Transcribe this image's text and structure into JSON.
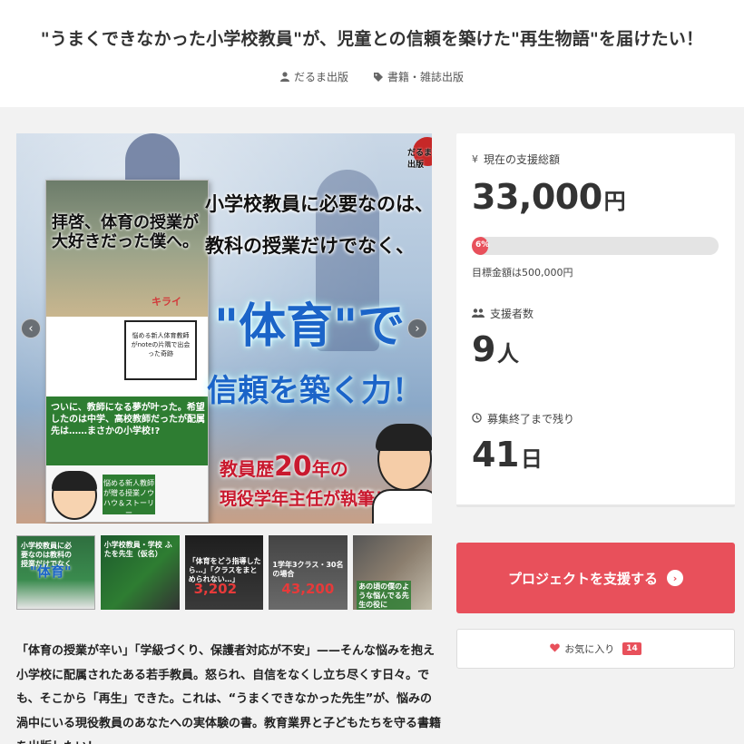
{
  "header": {
    "title": "\"うまくできなかった小学校教員\"が、児童との信頼を築けた\"再生物語\"を届けたい！",
    "author": "だるま出版",
    "category": "書籍・雑誌出版"
  },
  "hero": {
    "logo_text": "だるま出版",
    "line1": "小学校教員に必要なのは、",
    "line2": "教科の授業だけでなく、",
    "big1": "\"体育\"で",
    "big2": "信頼を築く力！",
    "red1_pre": "教員歴",
    "red1_num": "20",
    "red1_post": "年の",
    "red2": "現役学年主任が執筆！",
    "book_title": "拝啓、体育の授業が大好きだった僕へ。",
    "book_red": "キライ",
    "book_box": "悩める新人体育教師がnoteの片隅で出会った奇跡",
    "book_green": "ついに、教師になる夢が叶った。希望したのは中学、高校教師だったが配属先は……まさかの小学校!?",
    "book_tag": "悩める新人教師が贈る授業ノウハウ＆ストーリー",
    "prev_label": "‹",
    "next_label": "›"
  },
  "thumbs": [
    {
      "text": "小学校教員に必要なのは教科の授業だけでなく",
      "big": "\"体育\""
    },
    {
      "text": "小学校教員・学校 ふたを先生（仮名）",
      "big": ""
    },
    {
      "text": "「体育をどう指導したら…」「クラスをまとめられない…」",
      "big": "3,202"
    },
    {
      "text": "1学年3クラス・30名の場合",
      "big": "43,200"
    },
    {
      "text": "あの頃の僕のような悩んでる先生の役に",
      "big": ""
    }
  ],
  "description": "「体育の授業が辛い」「学級づくり、保護者対応が不安」——そんな悩みを抱え小学校に配属されたある若手教員。怒られ、自信をなくし立ち尽くす日々。でも、そこから「再生」できた。これは、“うまくできなかった先生”が、悩みの渦中にいる現役教員のあなたへの実体験の書。教育業界と子どもたちを守る書籍を出版したい！",
  "stats": {
    "total_label": "現在の支援総額",
    "total_value": "33,000",
    "total_unit": "円",
    "progress_percent": 6,
    "progress_label": "6%",
    "goal_text": "目標金額は500,000円",
    "supporters_label": "支援者数",
    "supporters_value": "9",
    "supporters_unit": "人",
    "remaining_label": "募集終了まで残り",
    "remaining_value": "41",
    "remaining_unit": "日"
  },
  "actions": {
    "support_label": "プロジェクトを支援する",
    "favorite_label": "お気に入り",
    "favorite_count": "14"
  },
  "colors": {
    "accent": "#e8505b",
    "hero_blue": "#1b64c8",
    "hero_red": "#c9192e"
  }
}
